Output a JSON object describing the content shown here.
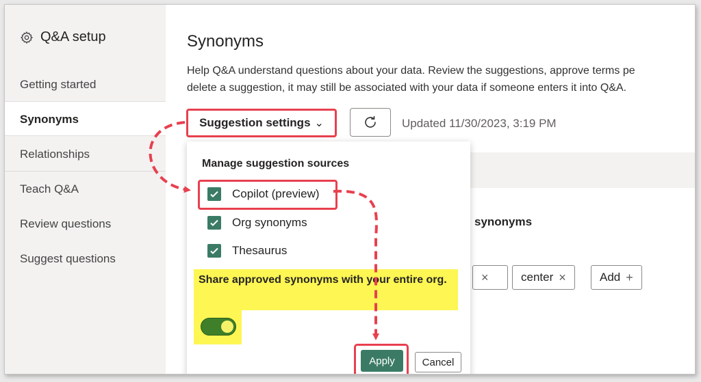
{
  "sidebar": {
    "title": "Q&A setup",
    "items": [
      {
        "label": "Getting started"
      },
      {
        "label": "Synonyms"
      },
      {
        "label": "Relationships"
      },
      {
        "label": "Teach Q&A"
      },
      {
        "label": "Review questions"
      },
      {
        "label": "Suggest questions"
      }
    ]
  },
  "main": {
    "title": "Synonyms",
    "description_line1": "Help Q&A understand questions about your data. Review the suggestions, approve terms pe",
    "description_line2": "delete a suggestion, it may still be associated with your data if someone enters it into Q&A.",
    "suggestion_settings_label": "Suggestion settings",
    "updated_text": "Updated 11/30/2023, 3:19 PM",
    "column_header": "synonyms",
    "chips": [
      {
        "label": "center"
      },
      {
        "label": "Add"
      }
    ]
  },
  "panel": {
    "heading": "Manage suggestion sources",
    "sources": [
      {
        "label": "Copilot (preview)",
        "checked": true
      },
      {
        "label": "Org synonyms",
        "checked": true
      },
      {
        "label": "Thesaurus",
        "checked": true
      }
    ],
    "share_text": "Share approved synonyms with your entire org.",
    "share_enabled": true,
    "apply_label": "Apply",
    "cancel_label": "Cancel"
  },
  "colors": {
    "accent_green": "#3b7b66",
    "highlight_red": "#e8404f",
    "highlight_yellow": "#fdf653"
  }
}
